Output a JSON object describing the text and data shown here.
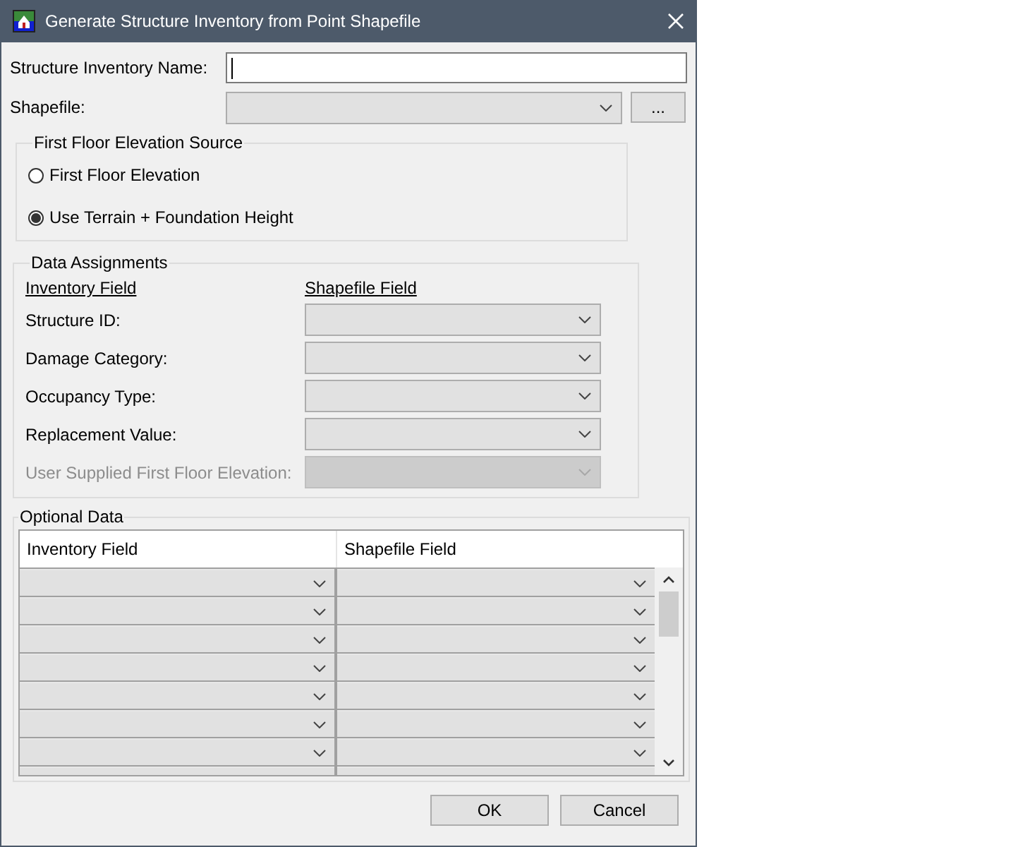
{
  "window": {
    "title": "Generate Structure Inventory from Point Shapefile"
  },
  "name_field": {
    "label": "Structure Inventory Name:"
  },
  "shapefile": {
    "label": "Shapefile:",
    "browse": "..."
  },
  "ffe_source": {
    "title": "First Floor Elevation Source",
    "options": [
      {
        "label": "First Floor Elevation",
        "selected": false
      },
      {
        "label": "Use Terrain + Foundation Height",
        "selected": true
      }
    ]
  },
  "data_assignments": {
    "title": "Data Assignments",
    "headers": [
      "Inventory Field",
      "Shapefile Field"
    ],
    "rows": [
      {
        "label": "Structure ID:",
        "disabled": false
      },
      {
        "label": "Damage Category:",
        "disabled": false
      },
      {
        "label": "Occupancy Type:",
        "disabled": false
      },
      {
        "label": "Replacement Value:",
        "disabled": false
      },
      {
        "label": "User Supplied First Floor Elevation:",
        "disabled": true
      }
    ]
  },
  "optional_data": {
    "title": "Optional Data",
    "columns": [
      "Inventory Field",
      "Shapefile Field"
    ],
    "rows": [
      {
        "disabled": false
      },
      {
        "disabled": false
      },
      {
        "disabled": false
      },
      {
        "disabled": false
      },
      {
        "disabled": false
      },
      {
        "disabled": false
      },
      {
        "disabled": false
      },
      {
        "disabled": false
      }
    ]
  },
  "buttons": [
    "OK",
    "Cancel"
  ]
}
